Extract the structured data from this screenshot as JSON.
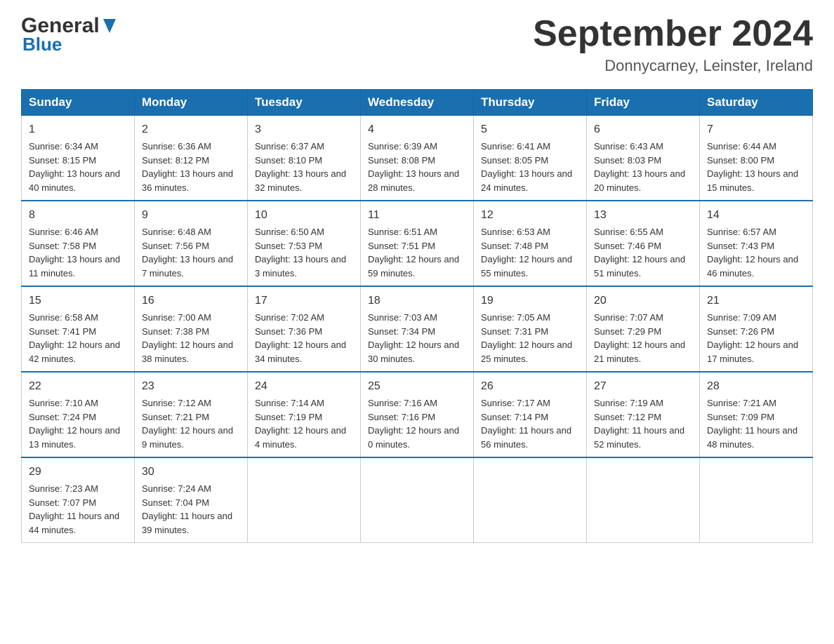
{
  "header": {
    "logo_general": "General",
    "logo_blue": "Blue",
    "month_title": "September 2024",
    "location": "Donnycarney, Leinster, Ireland"
  },
  "days_of_week": [
    "Sunday",
    "Monday",
    "Tuesday",
    "Wednesday",
    "Thursday",
    "Friday",
    "Saturday"
  ],
  "weeks": [
    [
      {
        "day": "1",
        "sunrise": "6:34 AM",
        "sunset": "8:15 PM",
        "daylight": "13 hours and 40 minutes."
      },
      {
        "day": "2",
        "sunrise": "6:36 AM",
        "sunset": "8:12 PM",
        "daylight": "13 hours and 36 minutes."
      },
      {
        "day": "3",
        "sunrise": "6:37 AM",
        "sunset": "8:10 PM",
        "daylight": "13 hours and 32 minutes."
      },
      {
        "day": "4",
        "sunrise": "6:39 AM",
        "sunset": "8:08 PM",
        "daylight": "13 hours and 28 minutes."
      },
      {
        "day": "5",
        "sunrise": "6:41 AM",
        "sunset": "8:05 PM",
        "daylight": "13 hours and 24 minutes."
      },
      {
        "day": "6",
        "sunrise": "6:43 AM",
        "sunset": "8:03 PM",
        "daylight": "13 hours and 20 minutes."
      },
      {
        "day": "7",
        "sunrise": "6:44 AM",
        "sunset": "8:00 PM",
        "daylight": "13 hours and 15 minutes."
      }
    ],
    [
      {
        "day": "8",
        "sunrise": "6:46 AM",
        "sunset": "7:58 PM",
        "daylight": "13 hours and 11 minutes."
      },
      {
        "day": "9",
        "sunrise": "6:48 AM",
        "sunset": "7:56 PM",
        "daylight": "13 hours and 7 minutes."
      },
      {
        "day": "10",
        "sunrise": "6:50 AM",
        "sunset": "7:53 PM",
        "daylight": "13 hours and 3 minutes."
      },
      {
        "day": "11",
        "sunrise": "6:51 AM",
        "sunset": "7:51 PM",
        "daylight": "12 hours and 59 minutes."
      },
      {
        "day": "12",
        "sunrise": "6:53 AM",
        "sunset": "7:48 PM",
        "daylight": "12 hours and 55 minutes."
      },
      {
        "day": "13",
        "sunrise": "6:55 AM",
        "sunset": "7:46 PM",
        "daylight": "12 hours and 51 minutes."
      },
      {
        "day": "14",
        "sunrise": "6:57 AM",
        "sunset": "7:43 PM",
        "daylight": "12 hours and 46 minutes."
      }
    ],
    [
      {
        "day": "15",
        "sunrise": "6:58 AM",
        "sunset": "7:41 PM",
        "daylight": "12 hours and 42 minutes."
      },
      {
        "day": "16",
        "sunrise": "7:00 AM",
        "sunset": "7:38 PM",
        "daylight": "12 hours and 38 minutes."
      },
      {
        "day": "17",
        "sunrise": "7:02 AM",
        "sunset": "7:36 PM",
        "daylight": "12 hours and 34 minutes."
      },
      {
        "day": "18",
        "sunrise": "7:03 AM",
        "sunset": "7:34 PM",
        "daylight": "12 hours and 30 minutes."
      },
      {
        "day": "19",
        "sunrise": "7:05 AM",
        "sunset": "7:31 PM",
        "daylight": "12 hours and 25 minutes."
      },
      {
        "day": "20",
        "sunrise": "7:07 AM",
        "sunset": "7:29 PM",
        "daylight": "12 hours and 21 minutes."
      },
      {
        "day": "21",
        "sunrise": "7:09 AM",
        "sunset": "7:26 PM",
        "daylight": "12 hours and 17 minutes."
      }
    ],
    [
      {
        "day": "22",
        "sunrise": "7:10 AM",
        "sunset": "7:24 PM",
        "daylight": "12 hours and 13 minutes."
      },
      {
        "day": "23",
        "sunrise": "7:12 AM",
        "sunset": "7:21 PM",
        "daylight": "12 hours and 9 minutes."
      },
      {
        "day": "24",
        "sunrise": "7:14 AM",
        "sunset": "7:19 PM",
        "daylight": "12 hours and 4 minutes."
      },
      {
        "day": "25",
        "sunrise": "7:16 AM",
        "sunset": "7:16 PM",
        "daylight": "12 hours and 0 minutes."
      },
      {
        "day": "26",
        "sunrise": "7:17 AM",
        "sunset": "7:14 PM",
        "daylight": "11 hours and 56 minutes."
      },
      {
        "day": "27",
        "sunrise": "7:19 AM",
        "sunset": "7:12 PM",
        "daylight": "11 hours and 52 minutes."
      },
      {
        "day": "28",
        "sunrise": "7:21 AM",
        "sunset": "7:09 PM",
        "daylight": "11 hours and 48 minutes."
      }
    ],
    [
      {
        "day": "29",
        "sunrise": "7:23 AM",
        "sunset": "7:07 PM",
        "daylight": "11 hours and 44 minutes."
      },
      {
        "day": "30",
        "sunrise": "7:24 AM",
        "sunset": "7:04 PM",
        "daylight": "11 hours and 39 minutes."
      },
      null,
      null,
      null,
      null,
      null
    ]
  ],
  "labels": {
    "sunrise": "Sunrise:",
    "sunset": "Sunset:",
    "daylight": "Daylight:"
  }
}
